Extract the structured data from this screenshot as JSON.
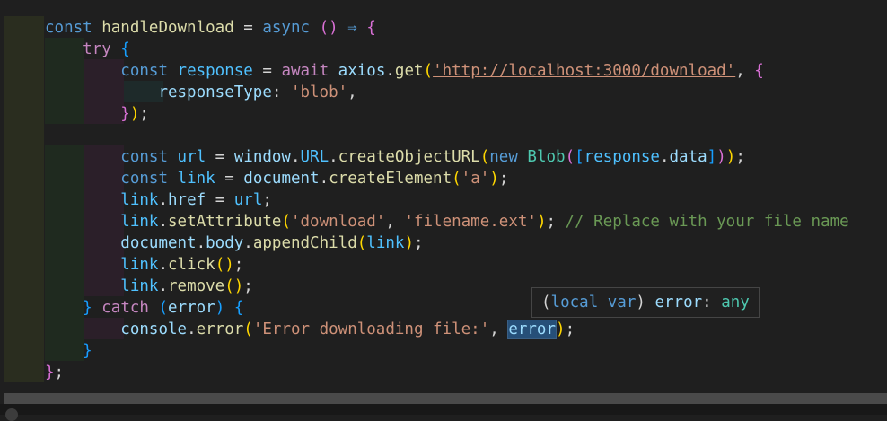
{
  "code_lines": [
    {
      "t": [
        [
          "kw",
          "const"
        ],
        [
          "op",
          " "
        ],
        [
          "fn",
          "handleDownload"
        ],
        [
          "op",
          " = "
        ],
        [
          "kw",
          "async"
        ],
        [
          "op",
          " "
        ],
        [
          "b2",
          "()"
        ],
        [
          "op",
          " "
        ],
        [
          "kw",
          "⇒"
        ],
        [
          "op",
          " "
        ],
        [
          "b2",
          "{"
        ]
      ]
    },
    {
      "t": [
        [
          "op",
          "    "
        ],
        [
          "ctl",
          "try"
        ],
        [
          "op",
          " "
        ],
        [
          "b3",
          "{"
        ]
      ]
    },
    {
      "t": [
        [
          "op",
          "        "
        ],
        [
          "kw",
          "const"
        ],
        [
          "op",
          " "
        ],
        [
          "const",
          "response"
        ],
        [
          "op",
          " = "
        ],
        [
          "ctl",
          "await"
        ],
        [
          "op",
          " "
        ],
        [
          "var",
          "axios"
        ],
        [
          "op",
          "."
        ],
        [
          "fn",
          "get"
        ],
        [
          "b1",
          "("
        ],
        [
          "str url",
          "'http://localhost:3000/download'"
        ],
        [
          "op",
          ", "
        ],
        [
          "b2",
          "{"
        ]
      ]
    },
    {
      "t": [
        [
          "op",
          "            "
        ],
        [
          "var",
          "responseType"
        ],
        [
          "op",
          ": "
        ],
        [
          "str",
          "'blob'"
        ],
        [
          "op",
          ","
        ]
      ]
    },
    {
      "t": [
        [
          "op",
          "        "
        ],
        [
          "b2",
          "}"
        ],
        [
          "b1",
          ")"
        ],
        [
          "op",
          ";"
        ]
      ]
    },
    {
      "t": []
    },
    {
      "t": [
        [
          "op",
          "        "
        ],
        [
          "kw",
          "const"
        ],
        [
          "op",
          " "
        ],
        [
          "const",
          "url"
        ],
        [
          "op",
          " = "
        ],
        [
          "var",
          "window"
        ],
        [
          "op",
          "."
        ],
        [
          "const",
          "URL"
        ],
        [
          "op",
          "."
        ],
        [
          "fn",
          "createObjectURL"
        ],
        [
          "b1",
          "("
        ],
        [
          "kw",
          "new"
        ],
        [
          "op",
          " "
        ],
        [
          "cls",
          "Blob"
        ],
        [
          "b2",
          "("
        ],
        [
          "b3",
          "["
        ],
        [
          "const",
          "response"
        ],
        [
          "op",
          "."
        ],
        [
          "var",
          "data"
        ],
        [
          "b3",
          "]"
        ],
        [
          "b2",
          ")"
        ],
        [
          "b1",
          ")"
        ],
        [
          "op",
          ";"
        ]
      ]
    },
    {
      "t": [
        [
          "op",
          "        "
        ],
        [
          "kw",
          "const"
        ],
        [
          "op",
          " "
        ],
        [
          "const",
          "link"
        ],
        [
          "op",
          " = "
        ],
        [
          "var",
          "document"
        ],
        [
          "op",
          "."
        ],
        [
          "fn",
          "createElement"
        ],
        [
          "b1",
          "("
        ],
        [
          "str",
          "'a'"
        ],
        [
          "b1",
          ")"
        ],
        [
          "op",
          ";"
        ]
      ]
    },
    {
      "t": [
        [
          "op",
          "        "
        ],
        [
          "const",
          "link"
        ],
        [
          "op",
          "."
        ],
        [
          "var",
          "href"
        ],
        [
          "op",
          " = "
        ],
        [
          "const",
          "url"
        ],
        [
          "op",
          ";"
        ]
      ]
    },
    {
      "t": [
        [
          "op",
          "        "
        ],
        [
          "const",
          "link"
        ],
        [
          "op",
          "."
        ],
        [
          "fn",
          "setAttribute"
        ],
        [
          "b1",
          "("
        ],
        [
          "str",
          "'download'"
        ],
        [
          "op",
          ", "
        ],
        [
          "str",
          "'filename.ext'"
        ],
        [
          "b1",
          ")"
        ],
        [
          "op",
          "; "
        ],
        [
          "cmt",
          "// Replace with your file name"
        ]
      ]
    },
    {
      "t": [
        [
          "op",
          "        "
        ],
        [
          "var",
          "document"
        ],
        [
          "op",
          "."
        ],
        [
          "var",
          "body"
        ],
        [
          "op",
          "."
        ],
        [
          "fn",
          "appendChild"
        ],
        [
          "b1",
          "("
        ],
        [
          "const",
          "link"
        ],
        [
          "b1",
          ")"
        ],
        [
          "op",
          ";"
        ]
      ]
    },
    {
      "t": [
        [
          "op",
          "        "
        ],
        [
          "const",
          "link"
        ],
        [
          "op",
          "."
        ],
        [
          "fn",
          "click"
        ],
        [
          "b1",
          "()"
        ],
        [
          "op",
          ";"
        ]
      ]
    },
    {
      "t": [
        [
          "op",
          "        "
        ],
        [
          "const",
          "link"
        ],
        [
          "op",
          "."
        ],
        [
          "fn",
          "remove"
        ],
        [
          "b1",
          "()"
        ],
        [
          "op",
          ";"
        ]
      ]
    },
    {
      "t": [
        [
          "op",
          "    "
        ],
        [
          "b3",
          "}"
        ],
        [
          "op",
          " "
        ],
        [
          "ctl",
          "catch"
        ],
        [
          "op",
          " "
        ],
        [
          "b3",
          "("
        ],
        [
          "var",
          "error"
        ],
        [
          "b3",
          ")"
        ],
        [
          "op",
          " "
        ],
        [
          "b3",
          "{"
        ]
      ]
    },
    {
      "t": [
        [
          "op",
          "        "
        ],
        [
          "var",
          "console"
        ],
        [
          "op",
          "."
        ],
        [
          "fn",
          "error"
        ],
        [
          "b1",
          "("
        ],
        [
          "str",
          "'Error downloading file:'"
        ],
        [
          "op",
          ", "
        ],
        [
          "var sel",
          "error"
        ],
        [
          "b1",
          ")"
        ],
        [
          "op",
          ";"
        ]
      ]
    },
    {
      "t": [
        [
          "op",
          "    "
        ],
        [
          "b3",
          "}"
        ]
      ]
    },
    {
      "t": [
        [
          "b2",
          "}"
        ],
        [
          "op",
          ";"
        ]
      ]
    }
  ],
  "hover_tooltip": {
    "prefix_paren_open": "(",
    "kind": "local var",
    "paren_close": ")",
    "name": " error",
    "colon": ": ",
    "type": "any"
  }
}
